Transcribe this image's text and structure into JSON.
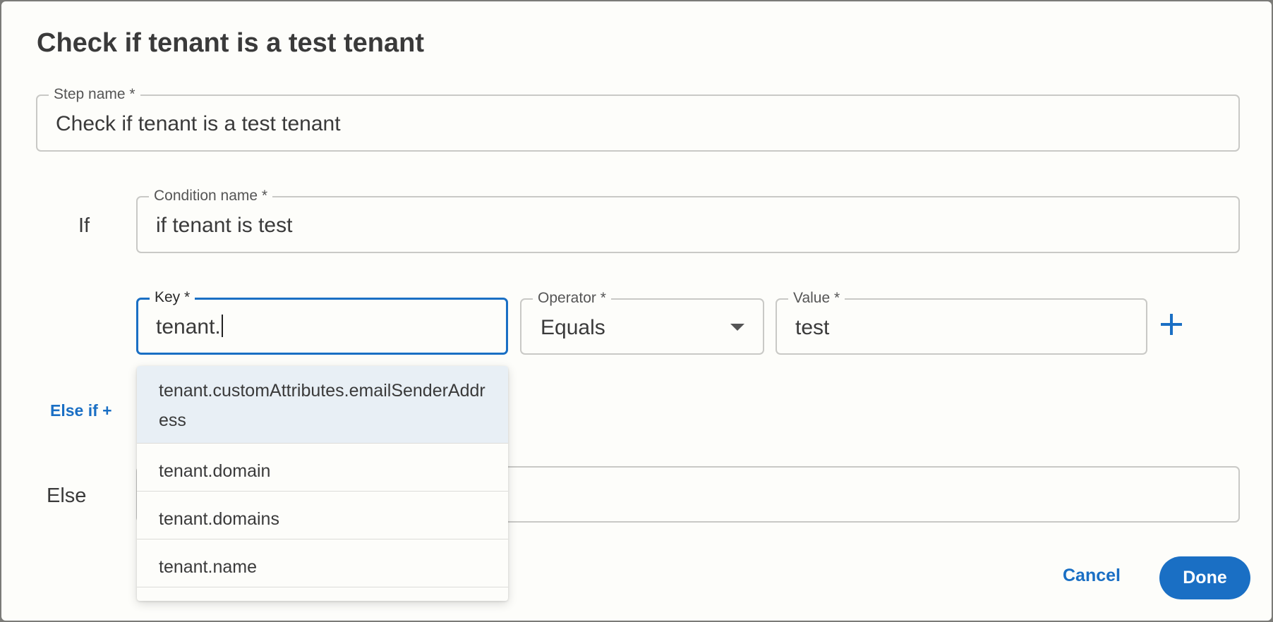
{
  "dialog": {
    "title": "Check if tenant is a test tenant"
  },
  "step_name": {
    "label": "Step name *",
    "value": "Check if tenant is a test tenant"
  },
  "if_block": {
    "label": "If",
    "condition_name": {
      "label": "Condition name *",
      "value": "if tenant is test"
    },
    "key": {
      "label": "Key *",
      "value": "tenant."
    },
    "operator": {
      "label": "Operator *",
      "value": "Equals"
    },
    "value_field": {
      "label": "Value *",
      "value": "test"
    }
  },
  "suggestions": [
    "tenant.customAttributes.emailSenderAddress",
    "tenant.domain",
    "tenant.domains",
    "tenant.name"
  ],
  "else_if_label": "Else if +",
  "else_block": {
    "label": "Else"
  },
  "actions": {
    "cancel_label": "Cancel",
    "done_label": "Done"
  },
  "colors": {
    "accent": "#1a6fc4",
    "focus_border": "#1a6fc4",
    "highlight_row": "#e8eff5"
  },
  "icons": {
    "add_condition": "plus-icon",
    "operator_dropdown": "caret-down-icon"
  }
}
